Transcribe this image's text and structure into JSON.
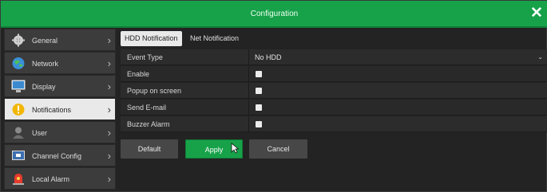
{
  "window": {
    "title": "Configuration",
    "close_label": "✕"
  },
  "colors": {
    "accent": "#17a24a",
    "active_item": "#e9e9e9",
    "panel": "#2c2c2c"
  },
  "sidebar": {
    "items": [
      {
        "label": "General",
        "icon": "gear-icon",
        "active": false
      },
      {
        "label": "Network",
        "icon": "globe-icon",
        "active": false
      },
      {
        "label": "Display",
        "icon": "monitor-icon",
        "active": false
      },
      {
        "label": "Notifications",
        "icon": "warning-icon",
        "active": true
      },
      {
        "label": "User",
        "icon": "user-icon",
        "active": false
      },
      {
        "label": "Channel Config",
        "icon": "camera-monitor-icon",
        "active": false
      },
      {
        "label": "Local Alarm",
        "icon": "alarm-icon",
        "active": false
      }
    ]
  },
  "tabs": [
    {
      "label": "HDD Notification",
      "active": true
    },
    {
      "label": "Net Notification",
      "active": false
    }
  ],
  "form": {
    "event_type": {
      "label": "Event Type",
      "value": "No HDD"
    },
    "enable": {
      "label": "Enable",
      "checked": false
    },
    "popup": {
      "label": "Popup on screen",
      "checked": false
    },
    "email": {
      "label": "Send E-mail",
      "checked": false
    },
    "buzzer": {
      "label": "Buzzer Alarm",
      "checked": false
    }
  },
  "buttons": {
    "default": "Default",
    "apply": "Apply",
    "cancel": "Cancel"
  }
}
